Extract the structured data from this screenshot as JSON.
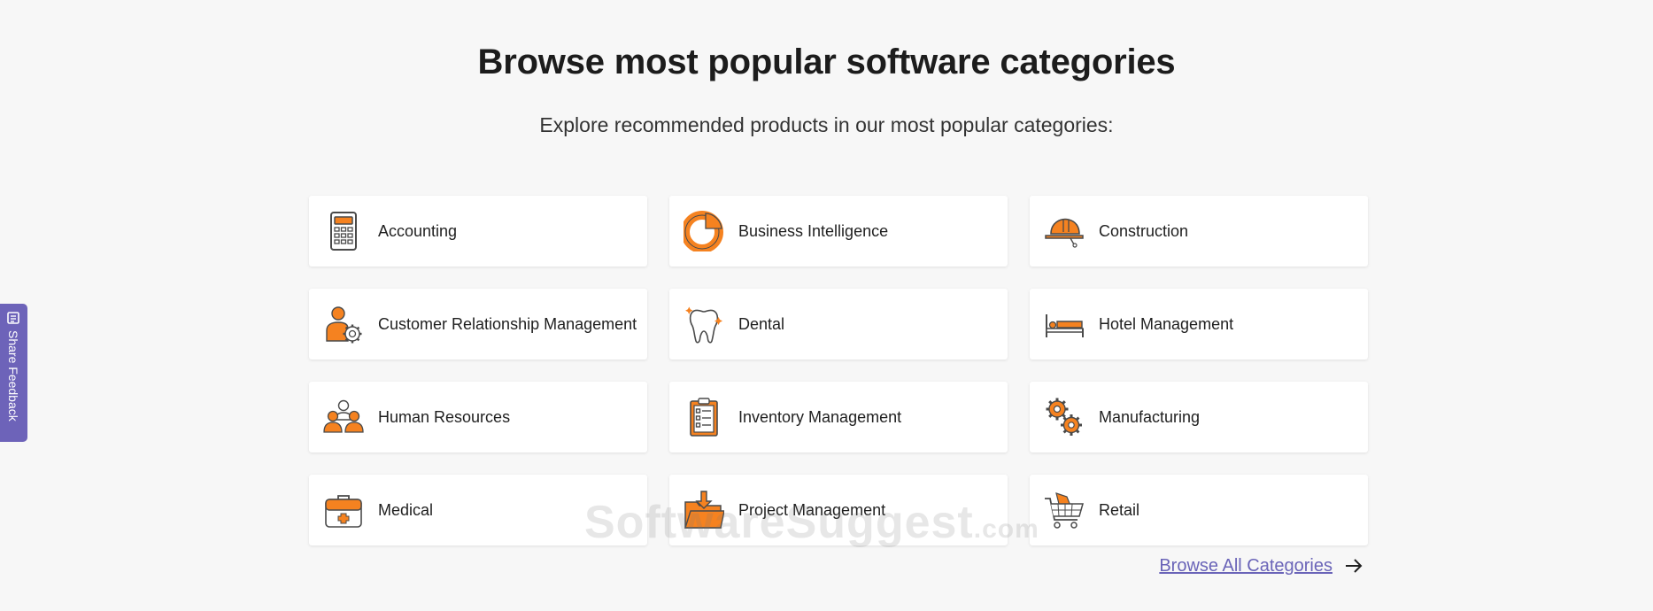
{
  "header": {
    "title": "Browse most popular software categories",
    "subtitle": "Explore recommended products in our most popular categories:"
  },
  "categories": [
    {
      "label": "Accounting",
      "icon": "calculator-icon"
    },
    {
      "label": "Business Intelligence",
      "icon": "pie-chart-icon"
    },
    {
      "label": "Construction",
      "icon": "hard-hat-icon"
    },
    {
      "label": "Customer Relationship Management",
      "icon": "user-gear-icon"
    },
    {
      "label": "Dental",
      "icon": "tooth-icon"
    },
    {
      "label": "Hotel Management",
      "icon": "bed-icon"
    },
    {
      "label": "Human Resources",
      "icon": "people-group-icon"
    },
    {
      "label": "Inventory Management",
      "icon": "clipboard-checklist-icon"
    },
    {
      "label": "Manufacturing",
      "icon": "gears-icon"
    },
    {
      "label": "Medical",
      "icon": "medical-kit-icon"
    },
    {
      "label": "Project Management",
      "icon": "folder-download-icon"
    },
    {
      "label": "Retail",
      "icon": "shopping-cart-icon"
    }
  ],
  "browse_all": {
    "label": "Browse All Categories",
    "icon": "arrow-right-icon"
  },
  "feedback_tab": {
    "label": "Share Feedback",
    "icon": "feedback-list-icon"
  },
  "watermark": {
    "text": "SoftwareSuggest",
    "domain": ".com"
  },
  "colors": {
    "accent": "#f58220",
    "dark_outline": "#4a4a4a",
    "link": "#6a64b8",
    "feedback_bg": "#6d63b9",
    "page_bg": "#f7f7f7"
  }
}
